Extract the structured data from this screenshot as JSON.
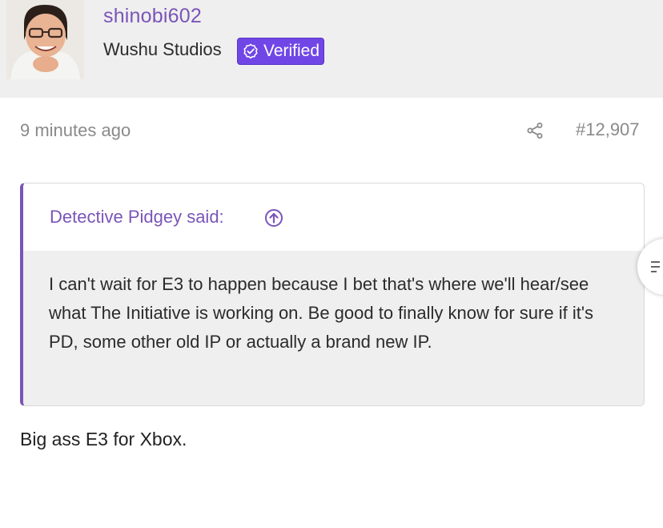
{
  "header": {
    "username": "shinobi602",
    "studio": "Wushu Studios",
    "badge_label": "Verified"
  },
  "post": {
    "timestamp": "9 minutes ago",
    "post_number": "#12,907",
    "quote": {
      "author_line": "Detective Pidgey said:",
      "text": "I can't wait for E3 to happen because I bet that's where we'll hear/see what The Initiative is working on. Be good to finally know for sure if it's PD, some other old IP or actually a brand new IP."
    },
    "reply_text": "Big ass E3 for Xbox."
  },
  "colors": {
    "accent": "#7a55b8",
    "badge": "#7046e6",
    "header_bg": "#efefef",
    "quote_body_bg": "#efefef",
    "meta_text": "#8a8a8a"
  },
  "icons": {
    "badge": "check-badge-icon",
    "share": "share-icon",
    "quote_jump": "arrow-up-circle-icon",
    "side": "menu-lines-icon"
  }
}
